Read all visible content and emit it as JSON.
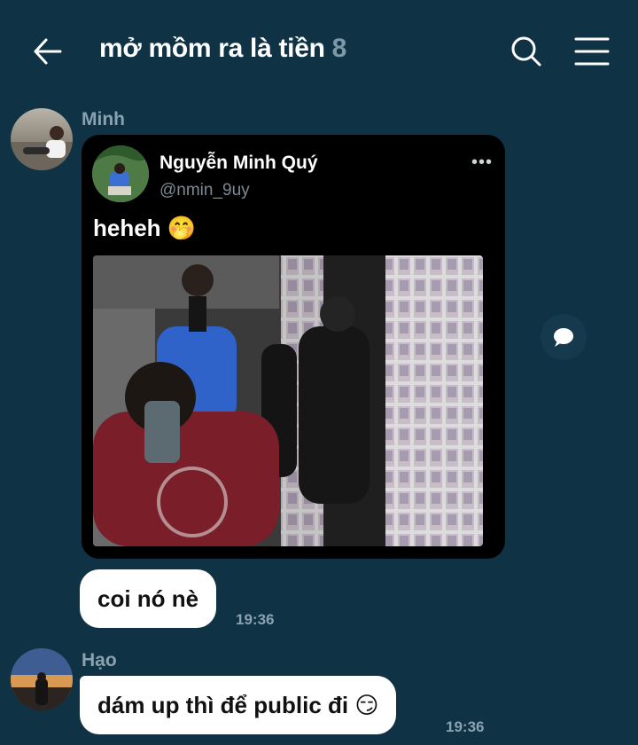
{
  "header": {
    "title": "mở mồm ra là tiền",
    "member_count": "8"
  },
  "messages": [
    {
      "sender": "Minh",
      "tweet": {
        "author": "Nguyễn Minh Quý",
        "handle": "@nmin_9uy",
        "more": "•••",
        "text": "heheh",
        "emoji": "🤭"
      }
    },
    {
      "text": "coi nó nè",
      "time": "19:36"
    },
    {
      "sender": "Hạo",
      "text": "dám up thì để public đi",
      "emoji": "😏",
      "time": "19:36"
    }
  ],
  "colors": {
    "background": "#0f3345",
    "bubble": "#ffffff",
    "muted": "#8aa2b0",
    "card": "#000000"
  },
  "icons": [
    "arrow-left-icon",
    "search-icon",
    "menu-icon",
    "share-icon"
  ]
}
